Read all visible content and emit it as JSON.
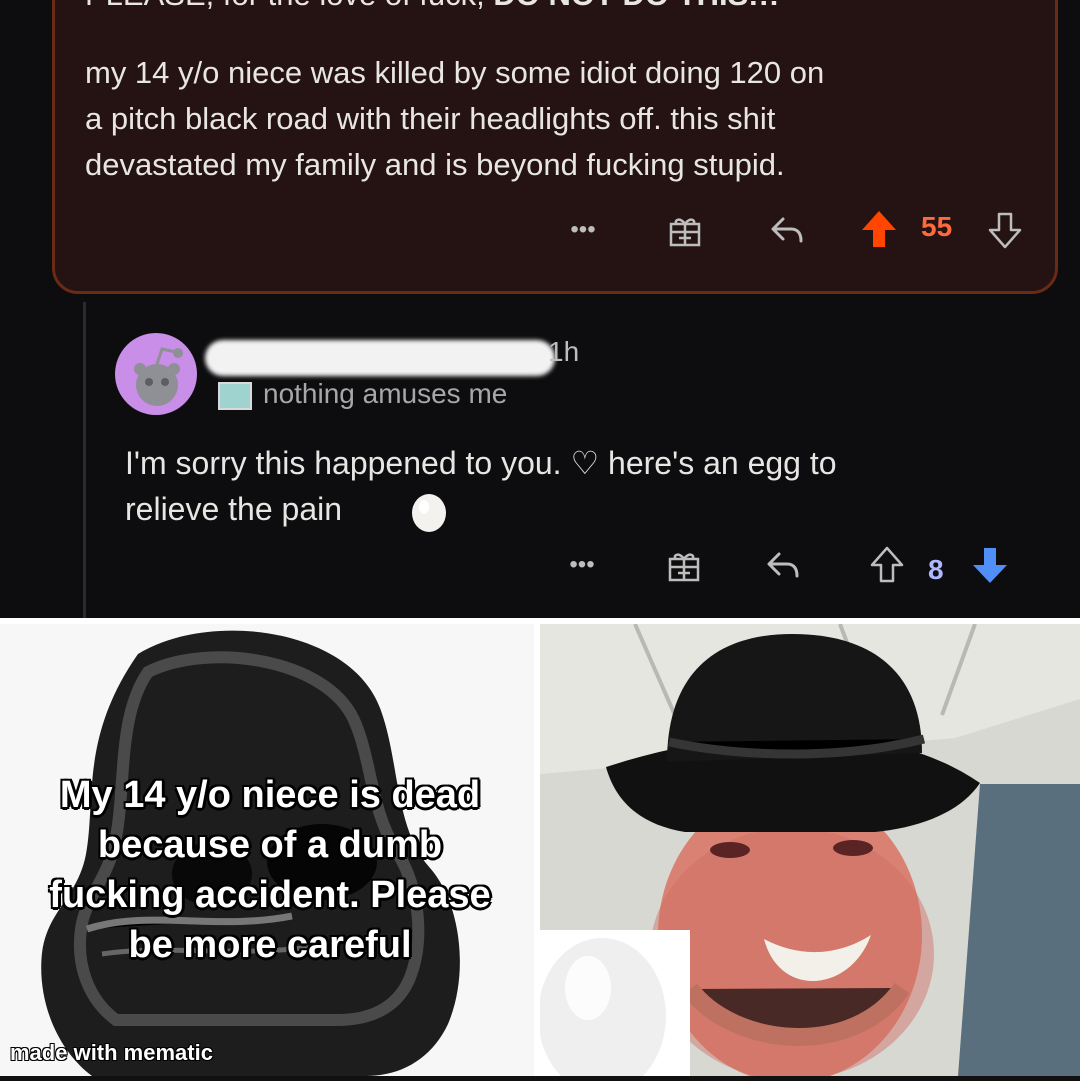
{
  "post": {
    "line1_regular": "PLEASE, for the love of fuck, ",
    "line1_bold": "DO NOT DO THIS!!!",
    "body_lines": [
      "my 14 y/o niece was killed by some idiot doing 120 on",
      "a pitch black road with their headlights off. this shit",
      "devastated my family and is beyond fucking stupid."
    ],
    "more_label": "•••",
    "vote_count": "55"
  },
  "reply": {
    "time": "1h",
    "flair": "nothing amuses me",
    "line1": "I'm sorry this happened to you. ♡ here's an egg to",
    "line2": "relieve the pain",
    "more_label": "•••",
    "vote_count": "8"
  },
  "meme": {
    "caption_lines": [
      "My 14 y/o niece is dead",
      "because of a dumb",
      "fucking accident. Please",
      "be more careful"
    ],
    "watermark": "made with mematic"
  },
  "colors": {
    "upvote_active": "#ff4500",
    "downvote_active": "#4f8ff7",
    "post_border": "#6b2a14",
    "post_bg": "#241312",
    "dark_bg": "#0d0d0f"
  }
}
